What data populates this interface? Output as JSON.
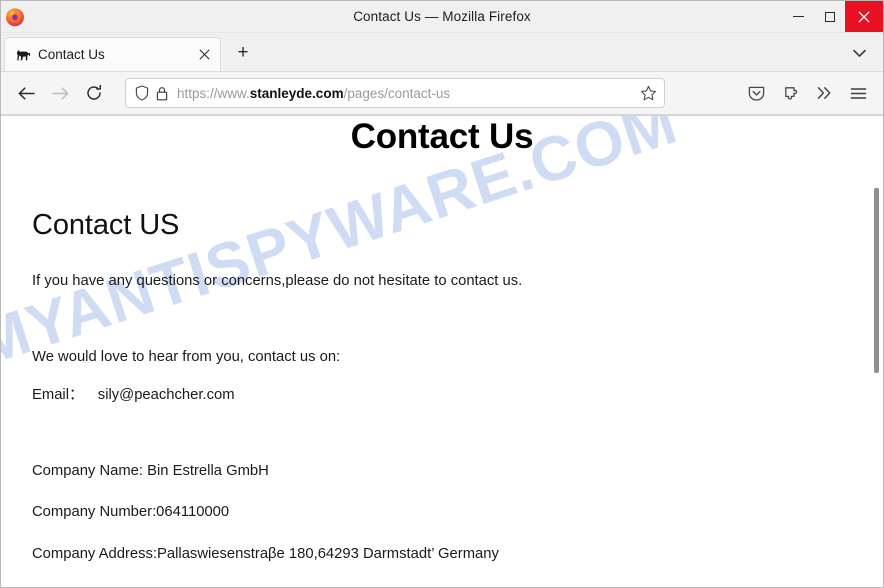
{
  "browser": {
    "window_title": "Contact Us — Mozilla Firefox",
    "app_logo_icon": "firefox-logo-icon",
    "window_controls": {
      "minimize_label": "—",
      "maximize_label": "□",
      "close_label": "×",
      "close_color": "#e81123"
    },
    "tabs": [
      {
        "title": "Contact Us",
        "favicon_icon": "site-favicon-animal-icon",
        "close_label": "✕",
        "active": true
      }
    ],
    "new_tab_label": "+",
    "tab_list_icon": "chevron-down-icon",
    "nav": {
      "back_icon": "arrow-left-icon",
      "forward_icon": "arrow-right-icon",
      "reload_icon": "reload-icon"
    },
    "urlbar": {
      "shield_icon": "shield-icon",
      "lock_icon": "padlock-icon",
      "scheme": "https://www.",
      "host": "stanleyde.com",
      "path": "/pages/contact-us",
      "full_url": "https://www.stanleyde.com/pages/contact-us",
      "bookmark_icon": "star-outline-icon"
    },
    "toolbar_right": [
      {
        "icon": "pocket-save-icon"
      },
      {
        "icon": "extensions-puzzle-icon"
      },
      {
        "icon": "overflow-chevrons-icon",
        "label": "»"
      },
      {
        "icon": "hamburger-menu-icon"
      }
    ]
  },
  "page": {
    "title": "Contact Us",
    "section_title": "Contact US",
    "paragraph_questions": "If you have any questions or concerns,please do not hesitate to contact us.",
    "paragraph_love": "We would love to hear from you, contact us on:",
    "email_label": "Email：",
    "email_value": "sily@peachcher.com",
    "company_name": "Company Name: Bin Estrella GmbH",
    "company_number": "Company Number:064110000",
    "company_address": "Company Address:Pallaswiesenstraβe 180,64293 Darmstadt’ Germany",
    "watermark_text": "MYANTISPYWARE.COM",
    "watermark_color": "#cfdcf4"
  }
}
